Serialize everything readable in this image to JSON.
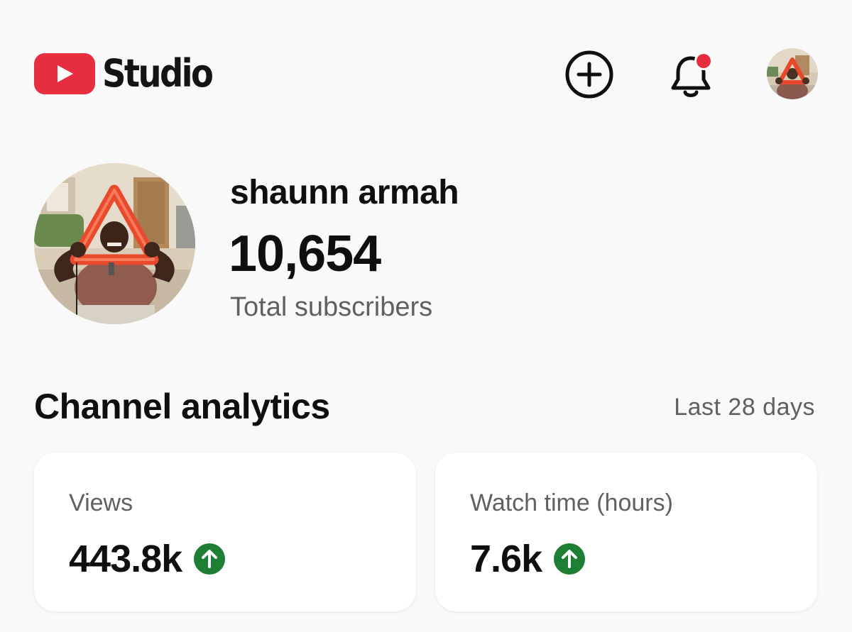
{
  "header": {
    "logo_text": "Studio",
    "brand_color": "#e62e3e",
    "notification_dot_color": "#e62e3e",
    "icons": [
      "youtube-play-icon",
      "create-plus-icon",
      "notifications-bell-icon",
      "account-avatar"
    ]
  },
  "channel": {
    "name": "shaunn armah",
    "subscriber_count": "10,654",
    "subscriber_label": "Total subscribers"
  },
  "analytics": {
    "title": "Channel analytics",
    "period": "Last 28 days",
    "trend_up_color": "#1e7e34",
    "cards": [
      {
        "label": "Views",
        "value": "443.8k",
        "trend": "up"
      },
      {
        "label": "Watch time (hours)",
        "value": "7.6k",
        "trend": "up"
      }
    ]
  }
}
